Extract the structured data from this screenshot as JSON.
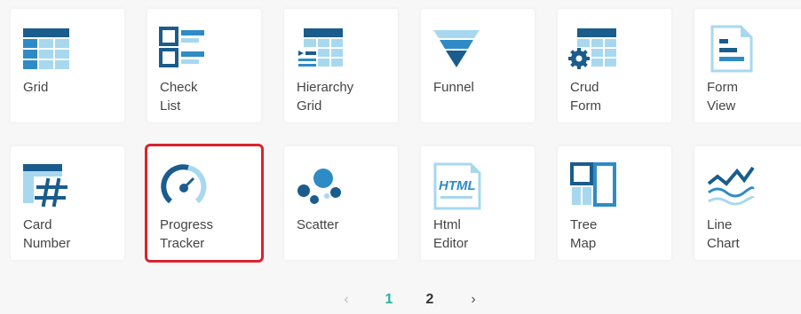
{
  "colors": {
    "dark_blue": "#1a5c8c",
    "mid_blue": "#2e8bc6",
    "light_blue": "#a7d8f0",
    "selected_outline": "#d9232d",
    "active_page": "#2ab0a0"
  },
  "tiles": [
    {
      "label": "Grid",
      "icon": "grid-icon"
    },
    {
      "label": "Check\nList",
      "icon": "checklist-icon"
    },
    {
      "label": "Hierarchy\nGrid",
      "icon": "hierarchy-grid-icon"
    },
    {
      "label": "Funnel",
      "icon": "funnel-icon"
    },
    {
      "label": "Crud\nForm",
      "icon": "crud-form-icon"
    },
    {
      "label": "Form\nView",
      "icon": "form-view-icon"
    },
    {
      "label": "Card\nNumber",
      "icon": "card-number-icon"
    },
    {
      "label": "Progress\nTracker",
      "icon": "progress-tracker-icon"
    },
    {
      "label": "Scatter",
      "icon": "scatter-icon"
    },
    {
      "label": "Html\nEditor",
      "icon": "html-editor-icon"
    },
    {
      "label": "Tree\nMap",
      "icon": "tree-map-icon"
    },
    {
      "label": "Line\nChart",
      "icon": "line-chart-icon"
    }
  ],
  "html_icon_text": "HTML",
  "pagination": {
    "prev": "‹",
    "pages": [
      "1",
      "2"
    ],
    "current": "1",
    "next": "›"
  }
}
